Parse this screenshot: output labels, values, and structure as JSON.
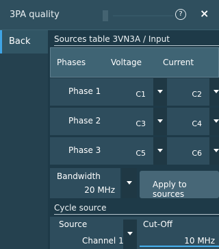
{
  "window": {
    "title": "3PA quality",
    "help_icon": "question-circle-icon",
    "close_icon": "close-icon",
    "help_glyph": "?",
    "close_glyph": "×"
  },
  "sidebar": {
    "back_label": "Back"
  },
  "sources_table": {
    "title": "Sources table 3VN3A / Input",
    "columns": [
      "Phases",
      "Voltage",
      "Current"
    ],
    "rows": [
      {
        "phase": "Phase 1",
        "voltage": "C1",
        "current": "C2"
      },
      {
        "phase": "Phase 2",
        "voltage": "C3",
        "current": "C4"
      },
      {
        "phase": "Phase 3",
        "voltage": "C5",
        "current": "C6"
      }
    ]
  },
  "bandwidth": {
    "label": "Bandwidth",
    "value": "20 MHz"
  },
  "apply_button": {
    "label": "Apply to sources"
  },
  "cycle_source": {
    "title": "Cycle source",
    "source_label": "Source",
    "source_value": "Channel 1",
    "cutoff_label": "Cut-Off",
    "cutoff_value": "10 MHz"
  },
  "colors": {
    "background": "#1e3a48",
    "accent": "#3fa5e6",
    "header": "#3f6474"
  }
}
